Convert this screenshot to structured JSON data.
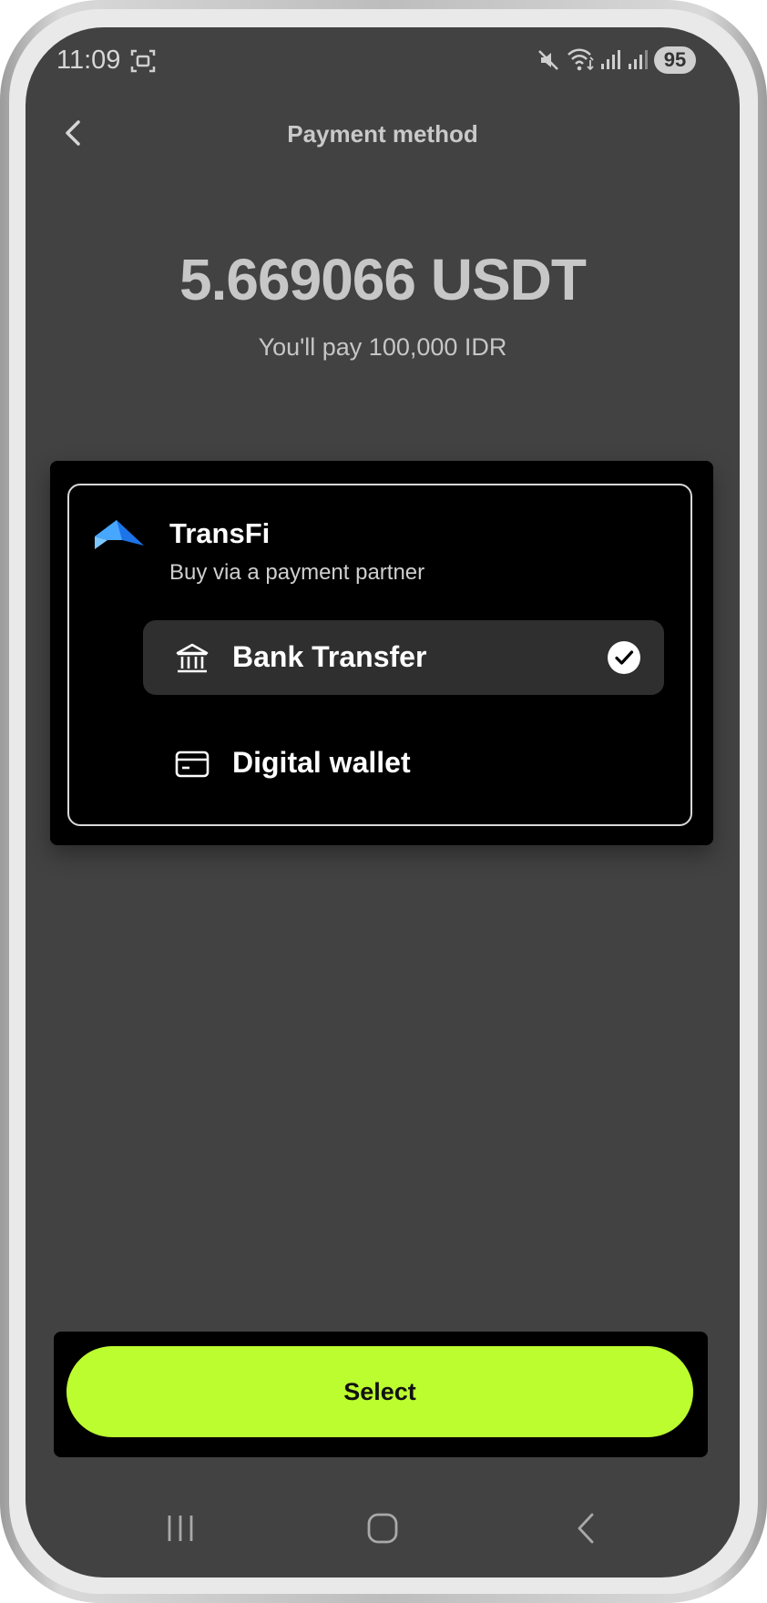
{
  "status_bar": {
    "time": "11:09",
    "battery": "95",
    "icons": [
      "screenshot-icon",
      "mute-icon",
      "wifi-icon",
      "signal-icon",
      "signal-icon"
    ]
  },
  "header": {
    "title": "Payment method",
    "back_icon": "chevron-left-icon"
  },
  "summary": {
    "amount": "5.669066 USDT",
    "pay_text": "You'll pay 100,000 IDR"
  },
  "provider": {
    "name": "TransFi",
    "description": "Buy via a payment partner",
    "logo_icon": "transfi-logo-icon",
    "options": [
      {
        "label": "Bank Transfer",
        "icon": "bank-icon",
        "selected": true
      },
      {
        "label": "Digital wallet",
        "icon": "wallet-card-icon",
        "selected": false
      }
    ]
  },
  "actions": {
    "select_label": "Select"
  },
  "navigation": {
    "items": [
      "recent-apps-icon",
      "home-icon",
      "back-icon"
    ]
  },
  "colors": {
    "accent": "#bcfd2f",
    "screen_bg": "#424242",
    "card_bg": "#000000",
    "selected_option_bg": "#2f2f2f"
  }
}
